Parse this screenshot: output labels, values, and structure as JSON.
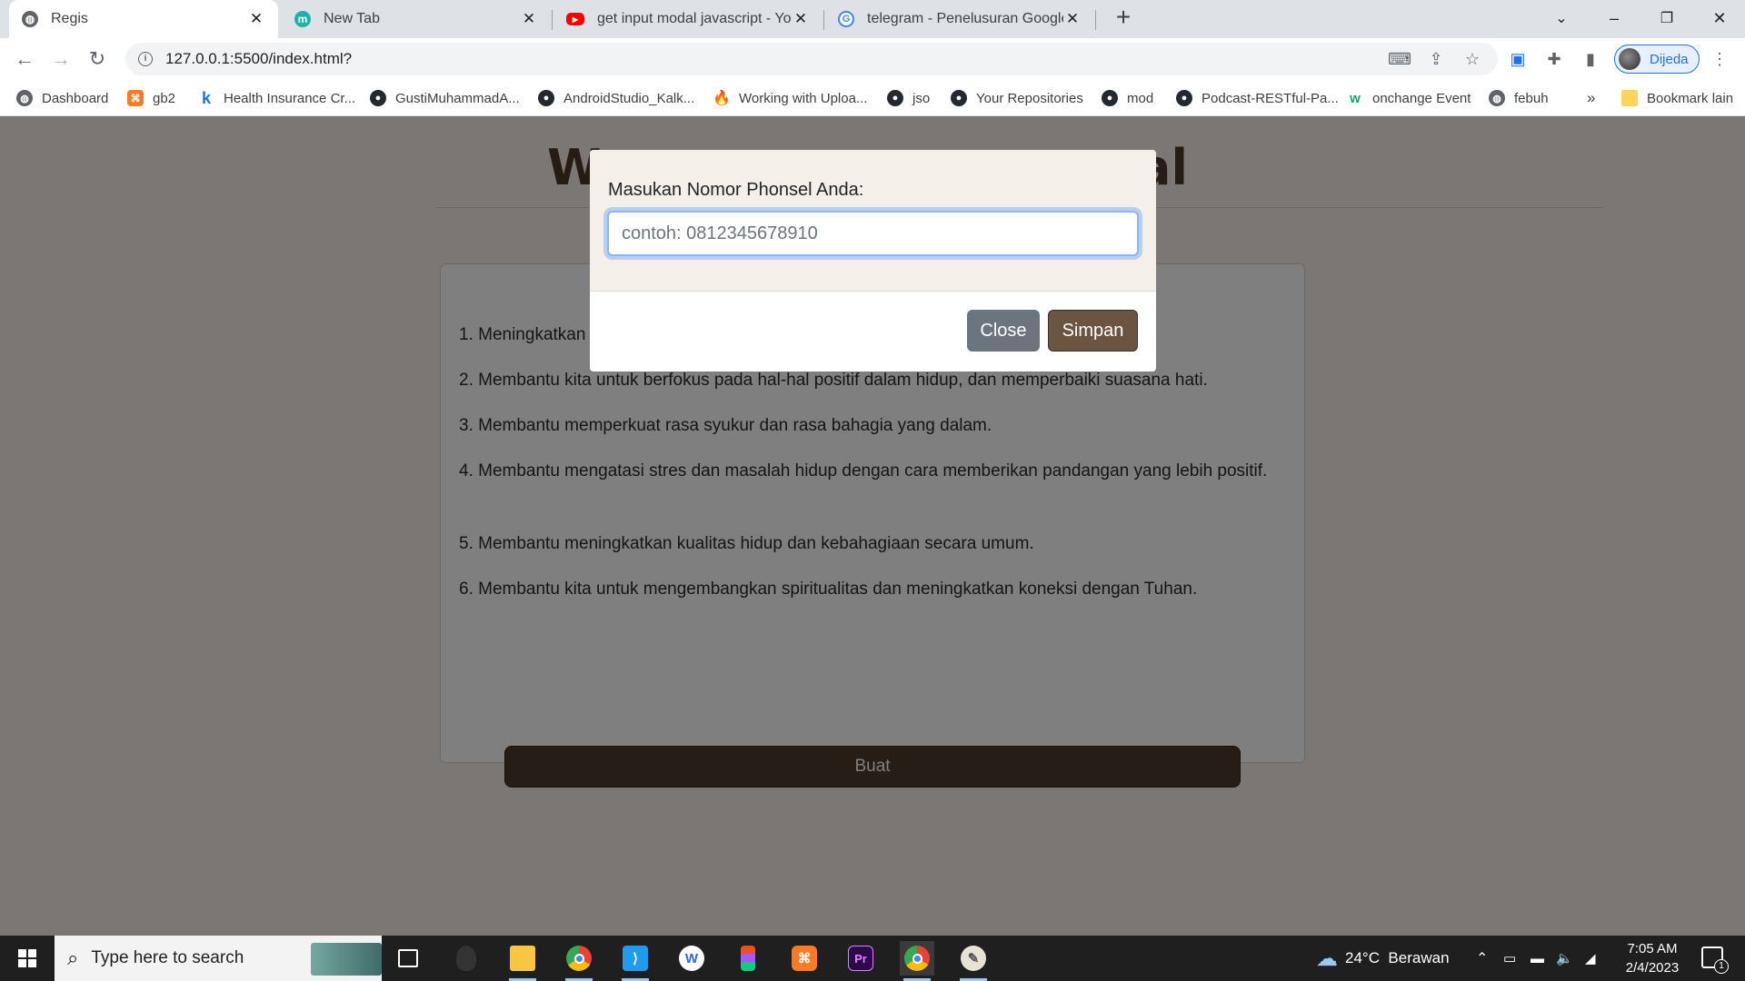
{
  "browser": {
    "tabs": [
      {
        "title": "Regis",
        "icon": "globe-icon",
        "active": true
      },
      {
        "title": "New Tab",
        "icon": "m-logo-icon",
        "active": false
      },
      {
        "title": "get input modal javascript - YouT",
        "icon": "youtube-icon",
        "active": false
      },
      {
        "title": "telegram - Penelusuran Google",
        "icon": "google-icon",
        "active": false
      }
    ],
    "url": "127.0.0.1:5500/index.html?",
    "profile_name": "Dijeda",
    "bookmarks": [
      {
        "label": "Dashboard",
        "icon": "globe-icon"
      },
      {
        "label": "gb2",
        "icon": "xampp-icon"
      },
      {
        "label": "Health Insurance Cr...",
        "icon": "k-icon"
      },
      {
        "label": "GustiMuhammadA...",
        "icon": "github-icon"
      },
      {
        "label": "AndroidStudio_Kalk...",
        "icon": "github-icon"
      },
      {
        "label": "Working with Uploa...",
        "icon": "fire-icon"
      },
      {
        "label": "jso",
        "icon": "github-icon"
      },
      {
        "label": "Your Repositories",
        "icon": "github-icon"
      },
      {
        "label": "mod",
        "icon": "github-icon"
      },
      {
        "label": "Podcast-RESTful-Pa...",
        "icon": "github-icon"
      },
      {
        "label": "onchange Event",
        "icon": "w3schools-icon"
      },
      {
        "label": "febuh",
        "icon": "globe-icon"
      }
    ],
    "bookmarks_overflow": "»",
    "other_bookmarks": "Bookmark lain"
  },
  "page": {
    "list": [
      "1. Meningkatkan",
      "2. Membantu kita untuk berfokus pada hal-hal positif dalam hidup, dan memperbaiki suasana hati.",
      "3. Membantu memperkuat rasa syukur dan rasa bahagia yang dalam.",
      "4. Membantu mengatasi stres dan masalah hidup dengan cara memberikan pandangan yang lebih positif.",
      "5. Membantu meningkatkan kualitas hidup dan kebahagiaan secara umum.",
      "6. Membantu kita untuk mengembangkan spiritualitas dan meningkatkan koneksi dengan Tuhan."
    ],
    "title_visible_left": "W",
    "title_visible_right": "al",
    "buat_label": "Buat"
  },
  "modal": {
    "label": "Masukan Nomor Phonsel Anda:",
    "input_placeholder": "contoh: 0812345678910",
    "input_value": "",
    "close_label": "Close",
    "save_label": "Simpan"
  },
  "taskbar": {
    "search_placeholder": "Type here to search",
    "weather": "24°C  Berawan",
    "time": "7:05 AM",
    "date": "2/4/2023",
    "notification_count": "1"
  },
  "colors": {
    "page_bg": "#f4efe9",
    "primary_brown": "#6b5541",
    "dark_brown": "#4b3a2c",
    "secondary_gray": "#6c757d",
    "focus_blue": "#86b7fe"
  }
}
